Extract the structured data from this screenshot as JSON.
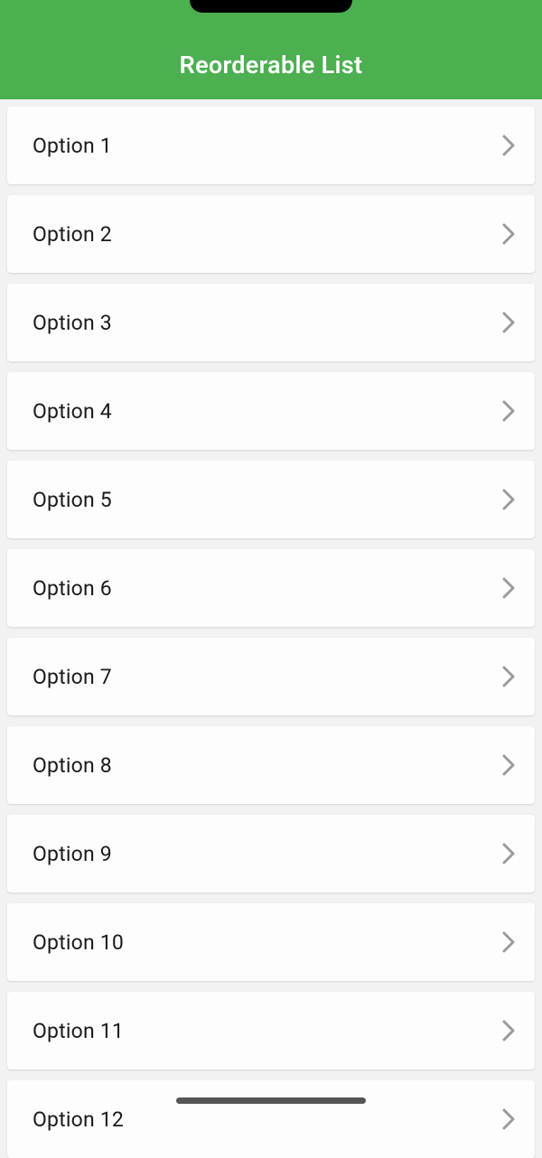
{
  "header": {
    "title": "Reorderable List"
  },
  "list": {
    "items": [
      {
        "label": "Option 1"
      },
      {
        "label": "Option 2"
      },
      {
        "label": "Option 3"
      },
      {
        "label": "Option 4"
      },
      {
        "label": "Option 5"
      },
      {
        "label": "Option 6"
      },
      {
        "label": "Option 7"
      },
      {
        "label": "Option 8"
      },
      {
        "label": "Option 9"
      },
      {
        "label": "Option 10"
      },
      {
        "label": "Option 11"
      },
      {
        "label": "Option 12"
      }
    ]
  }
}
